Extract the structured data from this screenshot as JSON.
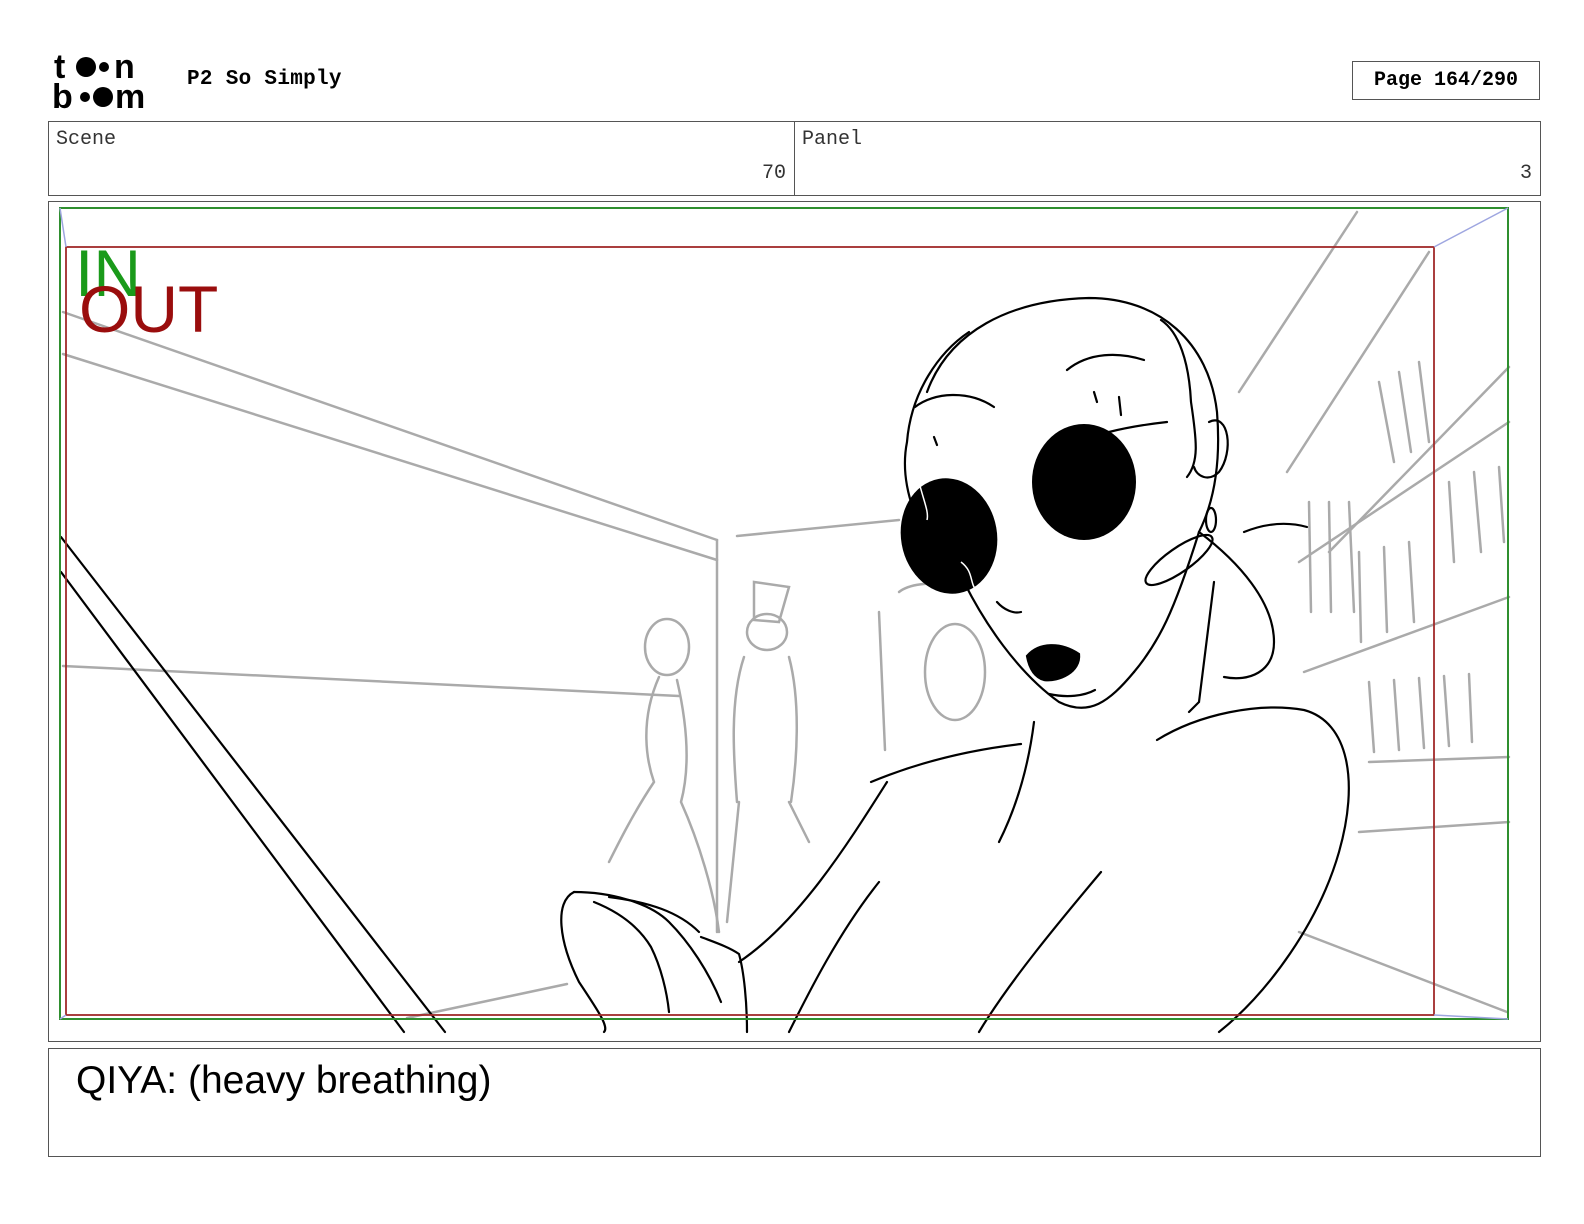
{
  "header": {
    "logo_text": "toon boom",
    "project_title": "P2 So Simply",
    "page_label": "Page 164/290"
  },
  "info": {
    "scene_label": "Scene",
    "scene_value": "70",
    "panel_label": "Panel",
    "panel_value": "3"
  },
  "panel": {
    "in_label": "IN",
    "out_label": "OUT",
    "in_color": "#1a9a1a",
    "out_color": "#9a0d0d"
  },
  "dialogue": {
    "text": "QIYA: (heavy breathing)"
  }
}
